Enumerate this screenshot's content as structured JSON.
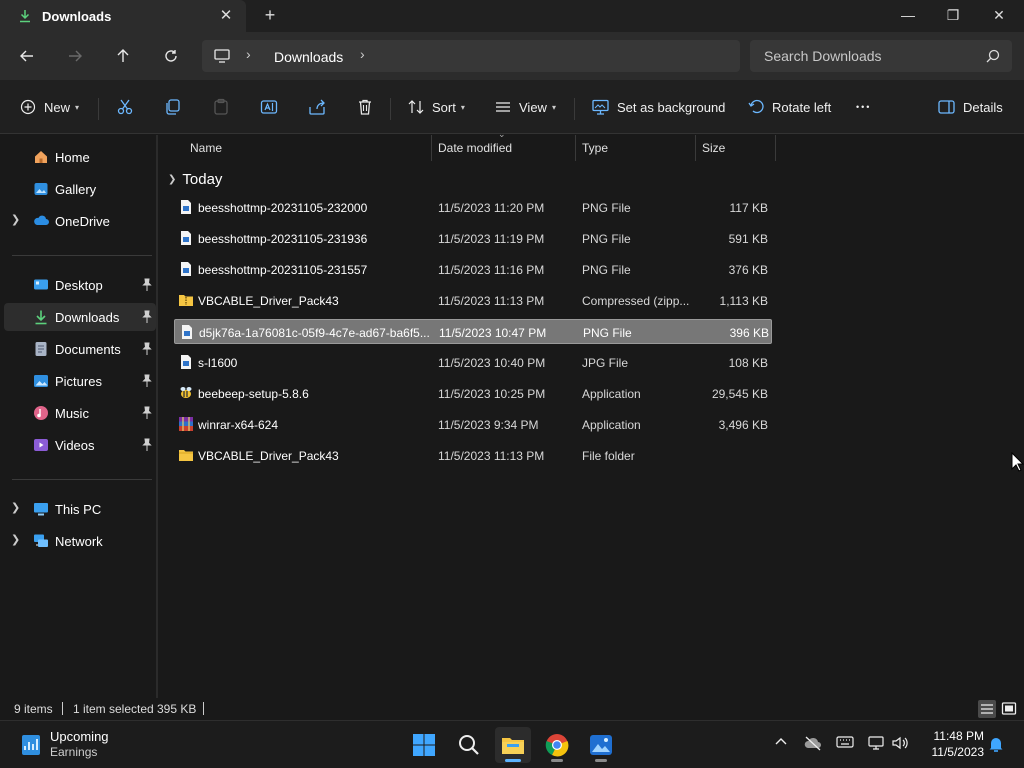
{
  "window": {
    "tab_title": "Downloads",
    "close_tab_glyph": "✕",
    "new_tab_glyph": "+",
    "minimize_glyph": "—",
    "restore_glyph": "❐",
    "close_glyph": "✕"
  },
  "address": {
    "crumb": "Downloads",
    "separator": "›",
    "search_placeholder": "Search Downloads"
  },
  "toolbar": {
    "new_label": "New",
    "sort_label": "Sort",
    "view_label": "View",
    "set_background_label": "Set as background",
    "rotate_left_label": "Rotate left",
    "more_glyph": "•••",
    "details_label": "Details"
  },
  "sidebar": {
    "items": [
      {
        "label": "Home",
        "icon": "home-icon"
      },
      {
        "label": "Gallery",
        "icon": "gallery-icon"
      },
      {
        "label": "OneDrive",
        "icon": "onedrive-icon",
        "expandable": true
      },
      {
        "label": "Desktop",
        "icon": "desktop-icon",
        "pinned": true
      },
      {
        "label": "Downloads",
        "icon": "downloads-icon",
        "pinned": true,
        "selected": true
      },
      {
        "label": "Documents",
        "icon": "documents-icon",
        "pinned": true
      },
      {
        "label": "Pictures",
        "icon": "pictures-icon",
        "pinned": true
      },
      {
        "label": "Music",
        "icon": "music-icon",
        "pinned": true
      },
      {
        "label": "Videos",
        "icon": "videos-icon",
        "pinned": true
      },
      {
        "label": "This PC",
        "icon": "this-pc-icon",
        "expandable": true
      },
      {
        "label": "Network",
        "icon": "network-icon",
        "expandable": true
      }
    ]
  },
  "filelist": {
    "columns": [
      "Name",
      "Date modified",
      "Type",
      "Size"
    ],
    "group": "Today",
    "rows": [
      {
        "name": "beesshottmp-20231105-232000",
        "date": "11/5/2023 11:20 PM",
        "type": "PNG File",
        "size": "117 KB",
        "icon": "image-file-icon"
      },
      {
        "name": "beesshottmp-20231105-231936",
        "date": "11/5/2023 11:19 PM",
        "type": "PNG File",
        "size": "591 KB",
        "icon": "image-file-icon"
      },
      {
        "name": "beesshottmp-20231105-231557",
        "date": "11/5/2023 11:16 PM",
        "type": "PNG File",
        "size": "376 KB",
        "icon": "image-file-icon"
      },
      {
        "name": "VBCABLE_Driver_Pack43",
        "date": "11/5/2023 11:13 PM",
        "type": "Compressed (zipp...",
        "size": "1,113 KB",
        "icon": "zip-folder-icon"
      },
      {
        "name": "d5jk76a-1a76081c-05f9-4c7e-ad67-ba6f5...",
        "date": "11/5/2023 10:47 PM",
        "type": "PNG File",
        "size": "396 KB",
        "icon": "image-file-icon",
        "selected": true
      },
      {
        "name": "s-l1600",
        "date": "11/5/2023 10:40 PM",
        "type": "JPG File",
        "size": "108 KB",
        "icon": "image-file-icon"
      },
      {
        "name": "beebeep-setup-5.8.6",
        "date": "11/5/2023 10:25 PM",
        "type": "Application",
        "size": "29,545 KB",
        "icon": "bee-app-icon"
      },
      {
        "name": "winrar-x64-624",
        "date": "11/5/2023 9:34 PM",
        "type": "Application",
        "size": "3,496 KB",
        "icon": "winrar-icon"
      },
      {
        "name": "VBCABLE_Driver_Pack43",
        "date": "11/5/2023 11:13 PM",
        "type": "File folder",
        "size": "",
        "icon": "folder-icon"
      }
    ]
  },
  "status": {
    "item_count": "9 items",
    "selection": "1 item selected",
    "selection_size": "395 KB"
  },
  "taskbar": {
    "weather_title": "Upcoming",
    "weather_subtitle": "Earnings",
    "time": "11:48 PM",
    "date": "11/5/2023"
  },
  "colors": {
    "accent": "#5cb3ff",
    "folder": "#f5c542",
    "selection": "#777777",
    "background": "#191919"
  }
}
